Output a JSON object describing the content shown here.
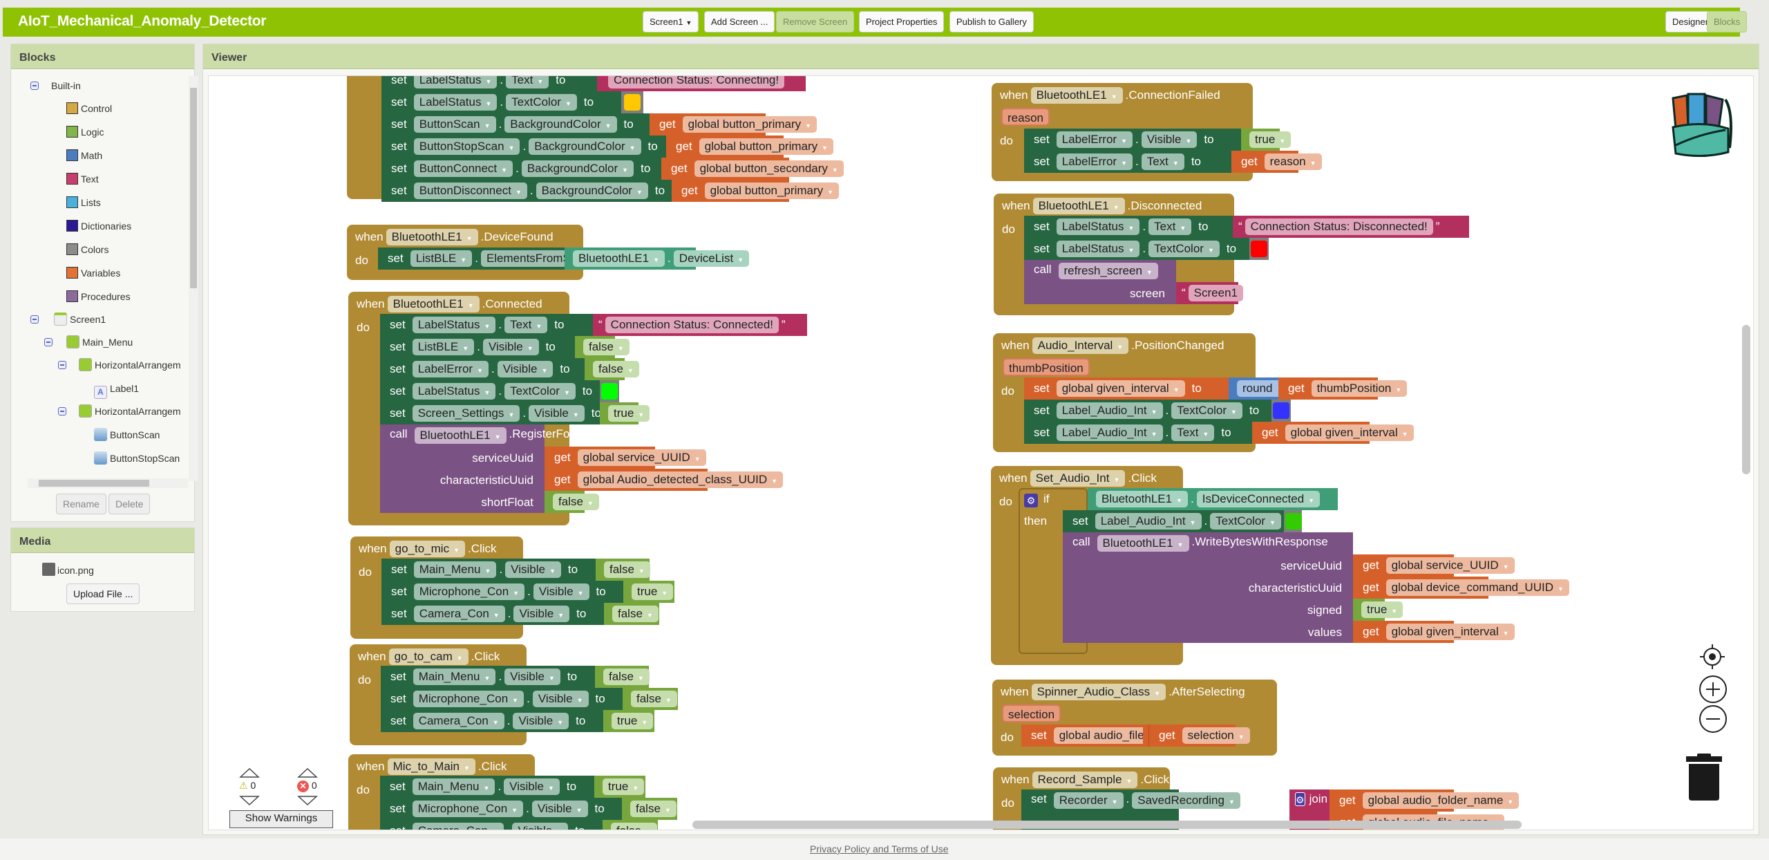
{
  "app": {
    "title": "AIoT_Mechanical_Anomaly_Detector",
    "toolbar": {
      "screen_select": "Screen1",
      "add_screen": "Add Screen ...",
      "remove_screen": "Remove Screen",
      "project_properties": "Project Properties",
      "publish": "Publish to Gallery",
      "designer": "Designer",
      "blocks": "Blocks"
    }
  },
  "blocks_panel": {
    "title": "Blocks",
    "builtin_label": "Built-in",
    "builtin": [
      {
        "label": "Control",
        "color": "#d4a843"
      },
      {
        "label": "Logic",
        "color": "#82b64a"
      },
      {
        "label": "Math",
        "color": "#4a7cbf"
      },
      {
        "label": "Text",
        "color": "#c73f6e"
      },
      {
        "label": "Lists",
        "color": "#4ab0dc"
      },
      {
        "label": "Dictionaries",
        "color": "#2c1896"
      },
      {
        "label": "Colors",
        "color": "#8c8c8c"
      },
      {
        "label": "Variables",
        "color": "#e27334"
      },
      {
        "label": "Procedures",
        "color": "#8e6a9a"
      }
    ],
    "components": [
      {
        "label": "Screen1"
      },
      {
        "label": "Main_Menu"
      },
      {
        "label": "HorizontalArrangem"
      },
      {
        "label": "Label1"
      },
      {
        "label": "HorizontalArrangem"
      },
      {
        "label": "ButtonScan"
      },
      {
        "label": "ButtonStopScan"
      }
    ],
    "rename": "Rename",
    "delete": "Delete"
  },
  "media_panel": {
    "title": "Media",
    "files": [
      "icon.png"
    ],
    "upload": "Upload File ..."
  },
  "viewer": {
    "title": "Viewer",
    "warnings_count": "0",
    "errors_count": "0",
    "show_warnings": "Show Warnings"
  },
  "workspace": {
    "top_partial": {
      "rows": [
        {
          "comp": "LabelStatus",
          "prop": "Text",
          "value_text": "Connection Status: Connecting!"
        },
        {
          "comp": "LabelStatus",
          "prop": "TextColor",
          "color": "#ffc800"
        },
        {
          "comp": "ButtonScan",
          "prop": "BackgroundColor",
          "get": "global button_primary"
        },
        {
          "comp": "ButtonStopScan",
          "prop": "BackgroundColor",
          "get": "global button_primary"
        },
        {
          "comp": "ButtonConnect",
          "prop": "BackgroundColor",
          "get": "global button_secondary"
        },
        {
          "comp": "ButtonDisconnect",
          "prop": "BackgroundColor",
          "get": "global button_primary"
        }
      ]
    },
    "device_found": {
      "component": "BluetoothLE1",
      "event": ".DeviceFound",
      "set_comp": "ListBLE",
      "set_prop": "ElementsFromString",
      "src_comp": "BluetoothLE1",
      "src_prop": "DeviceList"
    },
    "connected": {
      "component": "BluetoothLE1",
      "event": ".Connected",
      "status_text": "Connection Status: Connected!",
      "rows": [
        {
          "comp": "ListBLE",
          "prop": "Visible",
          "bool": "false"
        },
        {
          "comp": "LabelError",
          "prop": "Visible",
          "bool": "false"
        },
        {
          "comp": "LabelStatus",
          "prop": "TextColor",
          "color": "#00ff00"
        },
        {
          "comp": "Screen_Settings",
          "prop": "Visible",
          "bool": "true"
        }
      ],
      "call_comp": "BluetoothLE1",
      "method": ".RegisterForFloats",
      "args": [
        {
          "name": "serviceUuid",
          "get": "global service_UUID"
        },
        {
          "name": "characteristicUuid",
          "get": "global Audio_detected_class_UUID"
        },
        {
          "name": "shortFloat",
          "bool": "false"
        }
      ]
    },
    "go_to_mic": {
      "component": "go_to_mic",
      "event": ".Click",
      "rows": [
        {
          "comp": "Main_Menu",
          "prop": "Visible",
          "bool": "false"
        },
        {
          "comp": "Microphone_Con",
          "prop": "Visible",
          "bool": "true"
        },
        {
          "comp": "Camera_Con",
          "prop": "Visible",
          "bool": "false"
        }
      ]
    },
    "go_to_cam": {
      "component": "go_to_cam",
      "event": ".Click",
      "rows": [
        {
          "comp": "Main_Menu",
          "prop": "Visible",
          "bool": "false"
        },
        {
          "comp": "Microphone_Con",
          "prop": "Visible",
          "bool": "false"
        },
        {
          "comp": "Camera_Con",
          "prop": "Visible",
          "bool": "true"
        }
      ]
    },
    "mic_to_main": {
      "component": "Mic_to_Main",
      "event": ".Click",
      "rows": [
        {
          "comp": "Main_Menu",
          "prop": "Visible",
          "bool": "true"
        },
        {
          "comp": "Microphone_Con",
          "prop": "Visible",
          "bool": "false"
        },
        {
          "comp": "Camera_Con",
          "prop": "Visible",
          "bool": "false"
        }
      ]
    },
    "connection_failed": {
      "component": "BluetoothLE1",
      "event": ".ConnectionFailed",
      "param": "reason",
      "rows": [
        {
          "comp": "LabelError",
          "prop": "Visible",
          "bool": "true"
        },
        {
          "comp": "LabelError",
          "prop": "Text",
          "get": "reason"
        }
      ]
    },
    "disconnected": {
      "component": "BluetoothLE1",
      "event": ".Disconnected",
      "status_text": "Connection Status: Disconnected!",
      "color_comp": "LabelStatus",
      "color_prop": "TextColor",
      "color": "#ff0000",
      "text_comp": "LabelStatus",
      "text_prop": "Text",
      "call_proc": "refresh_screen",
      "arg_name": "screen",
      "arg_text": "Screen1"
    },
    "position_changed": {
      "component": "Audio_Interval",
      "event": ".PositionChanged",
      "param": "thumbPosition",
      "set_var": "global given_interval",
      "round": "round",
      "get": "thumbPosition",
      "color_comp": "Label_Audio_Int",
      "color_prop": "TextColor",
      "color": "#3333ff",
      "text_comp": "Label_Audio_Int",
      "text_prop": "Text",
      "text_get": "global given_interval"
    },
    "set_audio_int": {
      "component": "Set_Audio_Int",
      "event": ".Click",
      "if_comp": "BluetoothLE1",
      "if_prop": "IsDeviceConnected",
      "color_comp": "Label_Audio_Int",
      "color_prop": "TextColor",
      "color": "#33cc00",
      "call_comp": "BluetoothLE1",
      "method": ".WriteBytesWithResponse",
      "args": [
        {
          "name": "serviceUuid",
          "get": "global service_UUID"
        },
        {
          "name": "characteristicUuid",
          "get": "global device_command_UUID"
        },
        {
          "name": "signed",
          "bool": "true"
        },
        {
          "name": "values",
          "get": "global given_interval"
        }
      ]
    },
    "after_selecting": {
      "component": "Spinner_Audio_Class",
      "event": ".AfterSelecting",
      "param": "selection",
      "set_var": "global audio_file_name",
      "get": "selection"
    },
    "record_sample": {
      "component": "Record_Sample",
      "event": ".Click",
      "set_comp": "Recorder",
      "set_prop": "SavedRecording",
      "join": "join",
      "items": [
        "global audio_folder_name",
        "global audio_file_name"
      ]
    },
    "keywords": {
      "when": "when",
      "do": "do",
      "set": "set",
      "to": "to",
      "get": "get",
      "call": "call",
      "if": "if",
      "then": "then"
    }
  },
  "footer": {
    "link": "Privacy Policy and Terms of Use"
  }
}
